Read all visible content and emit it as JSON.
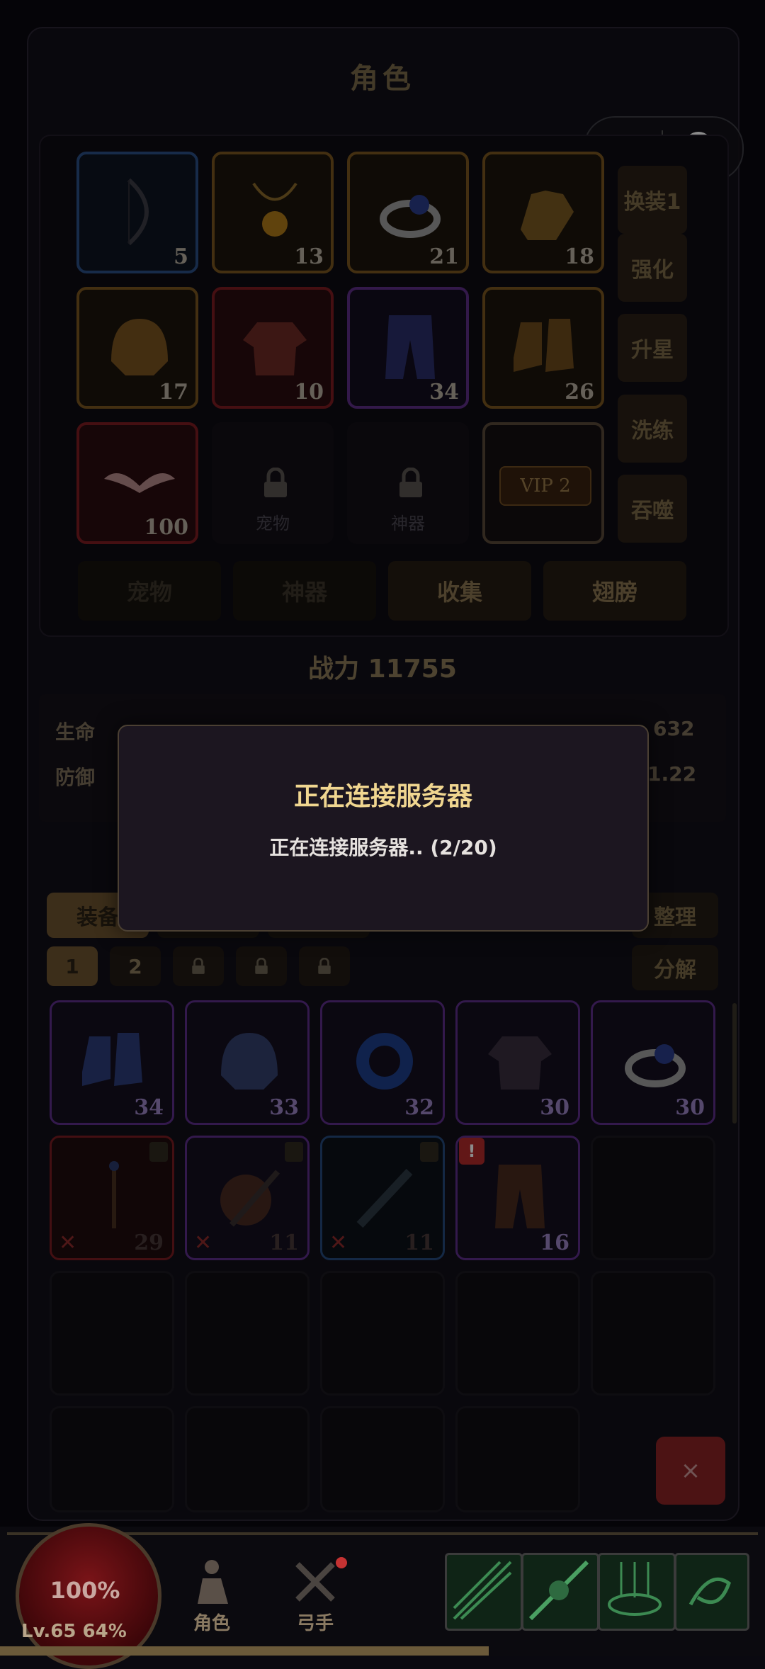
{
  "panel": {
    "title": "角色"
  },
  "equipment": {
    "row1": [
      {
        "num": "5"
      },
      {
        "num": "13"
      },
      {
        "num": "21"
      },
      {
        "num": "18"
      }
    ],
    "row2": [
      {
        "num": "17"
      },
      {
        "num": "10"
      },
      {
        "num": "34"
      },
      {
        "num": "26"
      }
    ],
    "row3": [
      {
        "num": "100"
      },
      {
        "label": "宠物"
      },
      {
        "label": "神器"
      },
      {
        "label": "VIP 2"
      }
    ]
  },
  "side_buttons": [
    "换装1",
    "强化",
    "升星",
    "洗练",
    "吞噬"
  ],
  "tabs": [
    "宠物",
    "神器",
    "收集",
    "翅膀"
  ],
  "power": "战力 11755",
  "stats": {
    "hp_label": "生命",
    "def_label": "防御",
    "hp_value": "632",
    "def_value": "1.22"
  },
  "dialog": {
    "title": "正在连接服务器",
    "message": "正在连接服务器.. (2/20)"
  },
  "inventory": {
    "tab_active": "装备",
    "sort_button": "整理",
    "decompose_button": "分解",
    "pages": [
      "1",
      "2"
    ],
    "row1": [
      "34",
      "33",
      "32",
      "30",
      "30"
    ],
    "row2": [
      "29",
      "11",
      "11",
      "16"
    ]
  },
  "close": "×",
  "hud": {
    "hp_pct": "100%",
    "level": "Lv.65  64%",
    "nav_character": "角色",
    "nav_archer": "弓手"
  }
}
